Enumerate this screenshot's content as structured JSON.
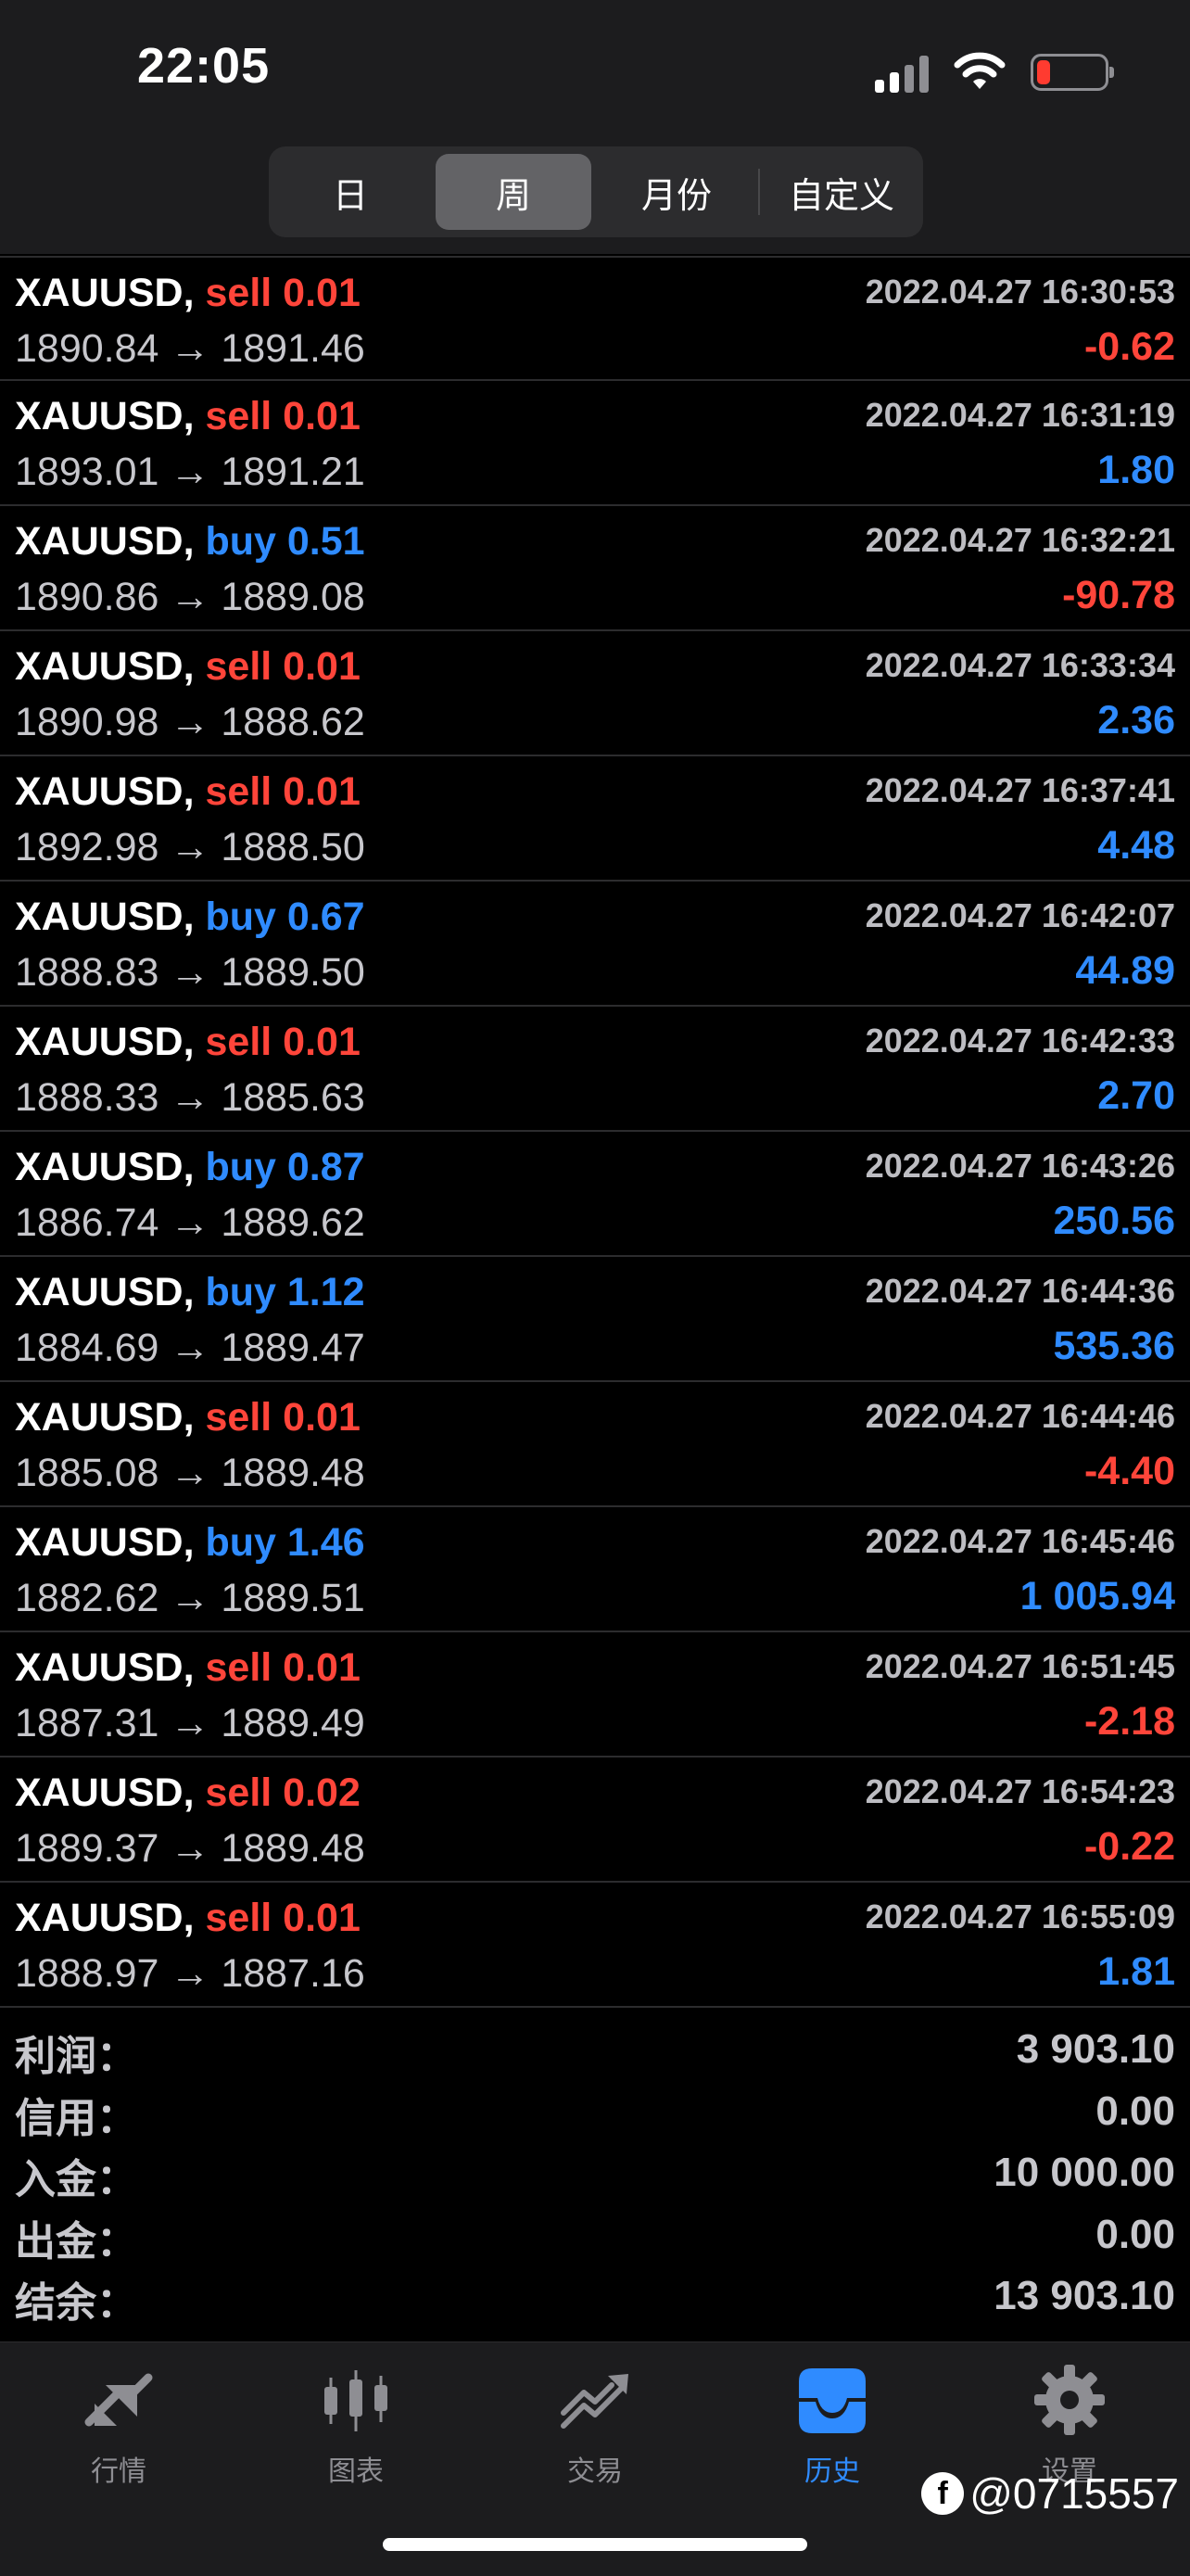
{
  "status_bar": {
    "time": "22:05",
    "signal_icon": "signal-bars-icon",
    "wifi_icon": "wifi-icon",
    "battery_icon": "battery-low-icon",
    "battery_color": "#ff3b30"
  },
  "period_tabs": {
    "items": [
      "日",
      "周",
      "月份",
      "自定义"
    ],
    "selected": "周"
  },
  "colors": {
    "sell": "#ff453a",
    "buy": "#2f8bff",
    "negative": "#ff453a",
    "positive": "#2f8bff",
    "background": "#000000"
  },
  "trades": [
    {
      "symbol": "XAUUSD,",
      "type": "sell",
      "volume": "0.01",
      "time": "2022.04.27 16:30:53",
      "open": "1890.84",
      "arrow": "→",
      "close": "1891.46",
      "profit": "-0.62"
    },
    {
      "symbol": "XAUUSD,",
      "type": "sell",
      "volume": "0.01",
      "time": "2022.04.27 16:31:19",
      "open": "1893.01",
      "arrow": "→",
      "close": "1891.21",
      "profit": "1.80"
    },
    {
      "symbol": "XAUUSD,",
      "type": "buy",
      "volume": "0.51",
      "time": "2022.04.27 16:32:21",
      "open": "1890.86",
      "arrow": "→",
      "close": "1889.08",
      "profit": "-90.78"
    },
    {
      "symbol": "XAUUSD,",
      "type": "sell",
      "volume": "0.01",
      "time": "2022.04.27 16:33:34",
      "open": "1890.98",
      "arrow": "→",
      "close": "1888.62",
      "profit": "2.36"
    },
    {
      "symbol": "XAUUSD,",
      "type": "sell",
      "volume": "0.01",
      "time": "2022.04.27 16:37:41",
      "open": "1892.98",
      "arrow": "→",
      "close": "1888.50",
      "profit": "4.48"
    },
    {
      "symbol": "XAUUSD,",
      "type": "buy",
      "volume": "0.67",
      "time": "2022.04.27 16:42:07",
      "open": "1888.83",
      "arrow": "→",
      "close": "1889.50",
      "profit": "44.89"
    },
    {
      "symbol": "XAUUSD,",
      "type": "sell",
      "volume": "0.01",
      "time": "2022.04.27 16:42:33",
      "open": "1888.33",
      "arrow": "→",
      "close": "1885.63",
      "profit": "2.70"
    },
    {
      "symbol": "XAUUSD,",
      "type": "buy",
      "volume": "0.87",
      "time": "2022.04.27 16:43:26",
      "open": "1886.74",
      "arrow": "→",
      "close": "1889.62",
      "profit": "250.56"
    },
    {
      "symbol": "XAUUSD,",
      "type": "buy",
      "volume": "1.12",
      "time": "2022.04.27 16:44:36",
      "open": "1884.69",
      "arrow": "→",
      "close": "1889.47",
      "profit": "535.36"
    },
    {
      "symbol": "XAUUSD,",
      "type": "sell",
      "volume": "0.01",
      "time": "2022.04.27 16:44:46",
      "open": "1885.08",
      "arrow": "→",
      "close": "1889.48",
      "profit": "-4.40"
    },
    {
      "symbol": "XAUUSD,",
      "type": "buy",
      "volume": "1.46",
      "time": "2022.04.27 16:45:46",
      "open": "1882.62",
      "arrow": "→",
      "close": "1889.51",
      "profit": "1 005.94"
    },
    {
      "symbol": "XAUUSD,",
      "type": "sell",
      "volume": "0.01",
      "time": "2022.04.27 16:51:45",
      "open": "1887.31",
      "arrow": "→",
      "close": "1889.49",
      "profit": "-2.18"
    },
    {
      "symbol": "XAUUSD,",
      "type": "sell",
      "volume": "0.02",
      "time": "2022.04.27 16:54:23",
      "open": "1889.37",
      "arrow": "→",
      "close": "1889.48",
      "profit": "-0.22"
    },
    {
      "symbol": "XAUUSD,",
      "type": "sell",
      "volume": "0.01",
      "time": "2022.04.27 16:55:09",
      "open": "1888.97",
      "arrow": "→",
      "close": "1887.16",
      "profit": "1.81"
    }
  ],
  "summary": [
    {
      "label": "利润：",
      "value": "3 903.10"
    },
    {
      "label": "信用：",
      "value": "0.00"
    },
    {
      "label": "入金：",
      "value": "10 000.00"
    },
    {
      "label": "出金：",
      "value": "0.00"
    },
    {
      "label": "结余：",
      "value": "13 903.10"
    }
  ],
  "tabbar": {
    "items": [
      {
        "label": "行情",
        "icon": "quotes-arrows-icon"
      },
      {
        "label": "图表",
        "icon": "candlestick-chart-icon"
      },
      {
        "label": "交易",
        "icon": "trade-trend-icon"
      },
      {
        "label": "历史",
        "icon": "history-inbox-icon"
      },
      {
        "label": "设置",
        "icon": "gear-icon"
      }
    ],
    "active": "历史",
    "active_color": "#2f8bff"
  },
  "watermark": {
    "logo": "f",
    "text": "@0715557"
  }
}
